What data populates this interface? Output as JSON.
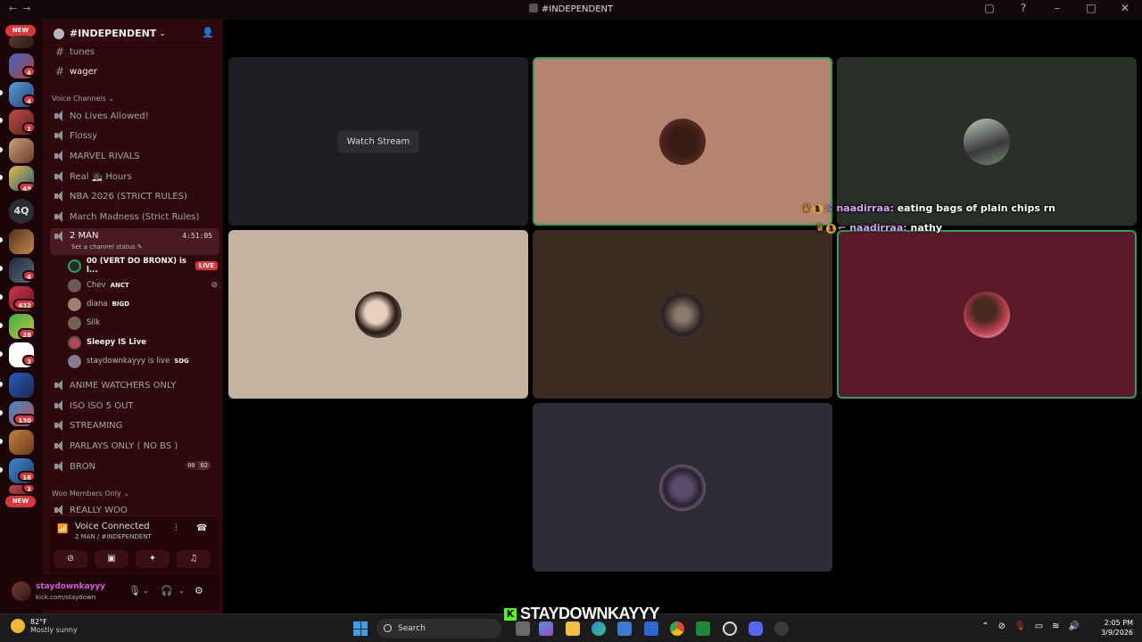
{
  "window": {
    "title": "#INDEPENDENT",
    "nav_back": "←",
    "nav_forward": "→"
  },
  "rail": {
    "new_top": "NEW",
    "new_bottom": "NEW",
    "badges": [
      "4",
      "4",
      "1",
      "49",
      "4",
      "432",
      "28",
      "3",
      "130",
      "16",
      "1"
    ],
    "text_server": "4Q"
  },
  "sidebar": {
    "server_name": "#INDEPENDENT",
    "text_channels": [
      "tunes",
      "wager"
    ],
    "voice_category": "Voice Channels",
    "voice_channels": [
      "No Lives Allowed!",
      "Flossy",
      "MARVEL RIVALS",
      "Real 🧑🏿‍🎨 Hours",
      "NBA 2026 (STRICT RULES)",
      "March Madness (Strict Rules)"
    ],
    "active_channel": {
      "name": "2 MAN",
      "timer": "4:51:05",
      "status_prompt": "Set a channel status"
    },
    "members": [
      {
        "name": "00 (VERT DO BRONX) is l...",
        "live": "LIVE"
      },
      {
        "name": "Chev",
        "tag": "ANCT"
      },
      {
        "name": "diana",
        "tag": "BIGD"
      },
      {
        "name": "Silk"
      },
      {
        "name": "Sleepy IS Live"
      },
      {
        "name": "staydownkayyy is live",
        "tag": "SDG"
      }
    ],
    "voice_channels_2": [
      "ANIME WATCHERS ONLY",
      "ISO ISO 5 OUT",
      "STREAMING",
      "PARLAYS ONLY ( NO BS )",
      "BRON"
    ],
    "bron_counts": [
      "00",
      "02"
    ],
    "woo_category": "Woo Members Only",
    "woo_channels": [
      "REALLY WOO"
    ]
  },
  "voice_panel": {
    "title": "Voice Connected",
    "subtitle": "2 MAN / #INDEPENDENT"
  },
  "user_panel": {
    "username": "staydownkayyy",
    "status": "kick.com/staydown"
  },
  "stage": {
    "watch_stream": "Watch Stream",
    "chat": [
      {
        "nick": "naadirraa:",
        "text": "eating bags of plain chips rn"
      },
      {
        "nick": "naadirraa:",
        "text": "nathy"
      }
    ]
  },
  "overlay": {
    "kick_k": "K",
    "streamer": "STAYDOWNKAYYY"
  },
  "taskbar": {
    "temp": "82°F",
    "weather": "Mostly sunny",
    "search_placeholder": "Search",
    "time": "2:05 PM",
    "date": "3/9/2026"
  },
  "colors": {
    "sidebar_bg": "#2e080d",
    "speaking_ring": "#23a55a",
    "live_red": "#da373c",
    "kick_green": "#53fc18"
  }
}
